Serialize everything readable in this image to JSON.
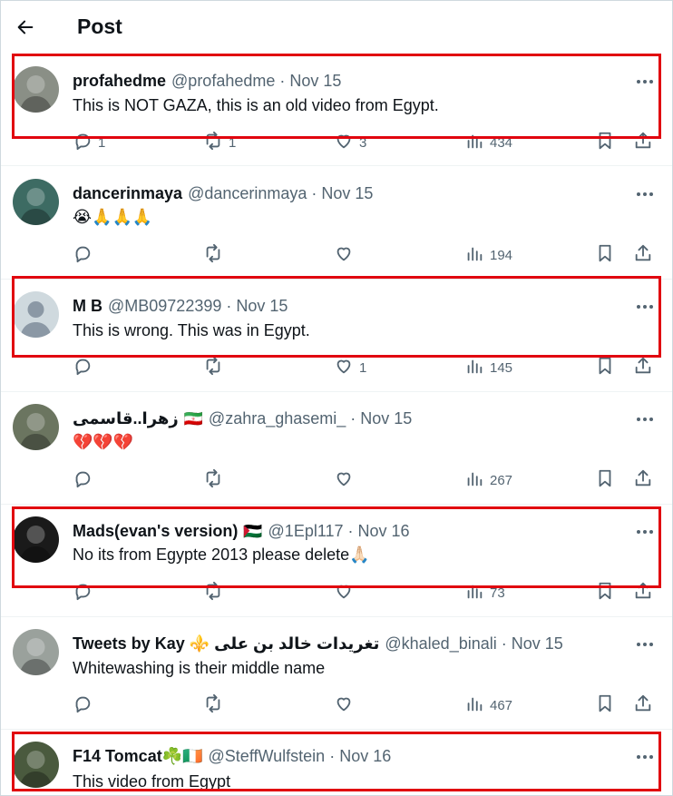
{
  "header": {
    "title": "Post"
  },
  "posts": [
    {
      "display_name": "profahedme",
      "meta": "@profahedme · Nov 15",
      "text": "This is NOT GAZA, this is an old video from Egypt.",
      "replies": "1",
      "retweets": "1",
      "likes": "3",
      "views": "434",
      "avatar_color": "#8a8f86"
    },
    {
      "display_name": "dancerinmaya",
      "meta": "@dancerinmaya · Nov 15",
      "text": "😭🙏🙏🙏",
      "replies": "",
      "retweets": "",
      "likes": "",
      "views": "194",
      "avatar_color": "#3d6b63"
    },
    {
      "display_name": "M B",
      "meta": "@MB09722399 · Nov 15",
      "text": "This is wrong.  This was in Egypt.",
      "replies": "",
      "retweets": "",
      "likes": "1",
      "views": "145",
      "avatar_color": "#cfd9de"
    },
    {
      "display_name": "زهرا..قاسمی",
      "flag": "🇮🇷",
      "meta": "@zahra_ghasemi_ · Nov 15",
      "text": "💔💔💔",
      "replies": "",
      "retweets": "",
      "likes": "",
      "views": "267",
      "avatar_color": "#6b7560"
    },
    {
      "display_name": "Mads(evan's version)",
      "flag": "🇵🇸",
      "meta": "@1Epl117 · Nov 16",
      "text": "No its from Egypte 2013 please delete🙏🏻",
      "replies": "",
      "retweets": "",
      "likes": "",
      "views": "73",
      "avatar_color": "#1a1a1a"
    },
    {
      "display_name": "Tweets by Kay ⚜️ تغريدات خالد بن على",
      "meta": "@khaled_binali · Nov 15",
      "text": "Whitewashing is their middle name",
      "replies": "",
      "retweets": "",
      "likes": "",
      "views": "467",
      "avatar_color": "#9aa19c"
    },
    {
      "display_name": "F14 Tomcat☘️🇮🇪",
      "meta": "@SteffWulfstein · Nov 16",
      "text": "This video from Egypt",
      "replies": "",
      "retweets": "",
      "likes": "",
      "views": "",
      "avatar_color": "#4a5a3e"
    }
  ],
  "colors": {
    "highlight": "#e1060f",
    "secondary_text": "#536471"
  },
  "icons": [
    "back-arrow-icon",
    "more-icon",
    "reply-icon",
    "retweet-icon",
    "like-icon",
    "views-icon",
    "bookmark-icon",
    "share-icon"
  ]
}
